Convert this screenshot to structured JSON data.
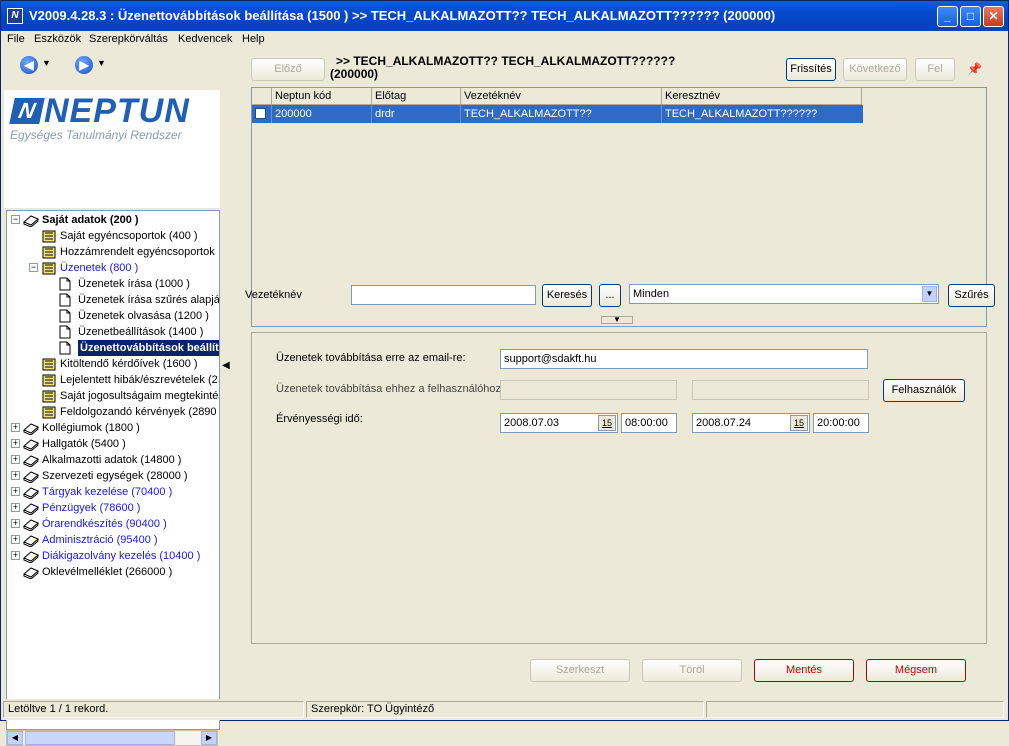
{
  "window": {
    "title": "V2009.4.28.3 : Üzenettovábbítások beállítása (1500  )  >> TECH_ALKALMAZOTT?? TECH_ALKALMAZOTT?????? (200000)",
    "app_icon": "N"
  },
  "menu": [
    "File",
    "Eszközök",
    "Szerepkörváltás",
    "Kedvencek",
    "Help"
  ],
  "logo": {
    "name": "NEPTUN",
    "subtitle": "Egységes Tanulmányi Rendszer"
  },
  "tree": [
    {
      "label": "Saját adatok (200  )",
      "level": 0,
      "expander": "−",
      "icon": "book-icon",
      "bold": true
    },
    {
      "label": "Saját egyéncsoportok (400  )",
      "level": 1,
      "icon": "book-icon"
    },
    {
      "label": "Hozzámrendelt egyéncsoportok",
      "level": 1,
      "icon": "book-icon"
    },
    {
      "label": "Üzenetek (800  )",
      "level": 1,
      "expander": "−",
      "icon": "book-icon",
      "blue": true
    },
    {
      "label": "Üzenetek írása (1000  )",
      "level": 2,
      "icon": "page-icon"
    },
    {
      "label": "Üzenetek írása szűrés alapján",
      "level": 2,
      "icon": "page-icon"
    },
    {
      "label": "Üzenetek olvasása (1200  )",
      "level": 2,
      "icon": "page-icon"
    },
    {
      "label": "Üzenetbeállítások (1400  )",
      "level": 2,
      "icon": "page-icon"
    },
    {
      "label": "Üzenettovábbítások beállítása",
      "level": 2,
      "icon": "page-icon",
      "selected": true
    },
    {
      "label": "Kitöltendő kérdőívek (1600  )",
      "level": 1,
      "icon": "book-icon"
    },
    {
      "label": "Lejelentett hibák/észrevételek (2",
      "level": 1,
      "icon": "book-icon"
    },
    {
      "label": "Saját jogosultságaim megtekintése",
      "level": 1,
      "icon": "book-icon"
    },
    {
      "label": "Feldolgozandó kérvények (2890",
      "level": 1,
      "icon": "book-icon"
    },
    {
      "label": "Kollégiumok (1800  )",
      "level": 0,
      "expander": "+",
      "icon": "book-icon"
    },
    {
      "label": "Hallgatók (5400  )",
      "level": 0,
      "expander": "+",
      "icon": "book-icon"
    },
    {
      "label": "Alkalmazotti adatok (14800  )",
      "level": 0,
      "expander": "+",
      "icon": "book-icon"
    },
    {
      "label": "Szervezeti egységek (28000  )",
      "level": 0,
      "expander": "+",
      "icon": "book-icon"
    },
    {
      "label": "Tárgyak kezelése (70400  )",
      "level": 0,
      "expander": "+",
      "icon": "book-icon",
      "blue": true
    },
    {
      "label": "Pénzügyek (78600  )",
      "level": 0,
      "expander": "+",
      "icon": "book-icon",
      "blue": true
    },
    {
      "label": "Órarendkészítés (90400  )",
      "level": 0,
      "expander": "+",
      "icon": "book-icon",
      "blue": true
    },
    {
      "label": "Adminisztráció (95400  )",
      "level": 0,
      "expander": "+",
      "icon": "book-icon",
      "blue": true
    },
    {
      "label": "Diákigazolvány kezelés (10400  )",
      "level": 0,
      "expander": "+",
      "icon": "book-icon",
      "blue": true
    },
    {
      "label": "Oklevélmelléklet (266000  )",
      "level": 0,
      "icon": "book-icon"
    }
  ],
  "header": {
    "prev_label": "Előző",
    "title": ">> TECH_ALKALMAZOTT?? TECH_ALKALMAZOTT??????",
    "title_line2": "(200000)",
    "refresh_label": "Frissítés",
    "next_label": "Következő",
    "up_label": "Fel"
  },
  "grid": {
    "columns": [
      "Neptun kód",
      "Előtag",
      "Vezetéknév",
      "Keresztnév"
    ],
    "rows": [
      [
        "200000",
        "drdr",
        "TECH_ALKALMAZOTT??",
        "TECH_ALKALMAZOTT??????"
      ]
    ]
  },
  "search": {
    "label": "Vezetéknév",
    "value": "",
    "search_label": "Keresés",
    "more_label": "...",
    "filter_value": "Minden",
    "filter_label": "Szűrés"
  },
  "form": {
    "email_label": "Üzenetek továbbítása erre az email-re:",
    "email_value": "support@sdakft.hu",
    "user_label": "Üzenetek továbbítása ehhez a felhasználóhoz:",
    "users_button": "Felhasználók",
    "validity_label": "Érvényességi idő:",
    "from_date": "2008.07.03",
    "from_time": "08:00:00",
    "to_date": "2008.07.24",
    "to_time": "20:00:00",
    "cal_icon": "15"
  },
  "actions": {
    "edit_label": "Szerkeszt",
    "delete_label": "Töröl",
    "save_label": "Mentés",
    "cancel_label": "Mégsem"
  },
  "status": {
    "loaded": "Letöltve 1 / 1 rekord.",
    "role": "Szerepkör: TO Ügyintéző"
  }
}
